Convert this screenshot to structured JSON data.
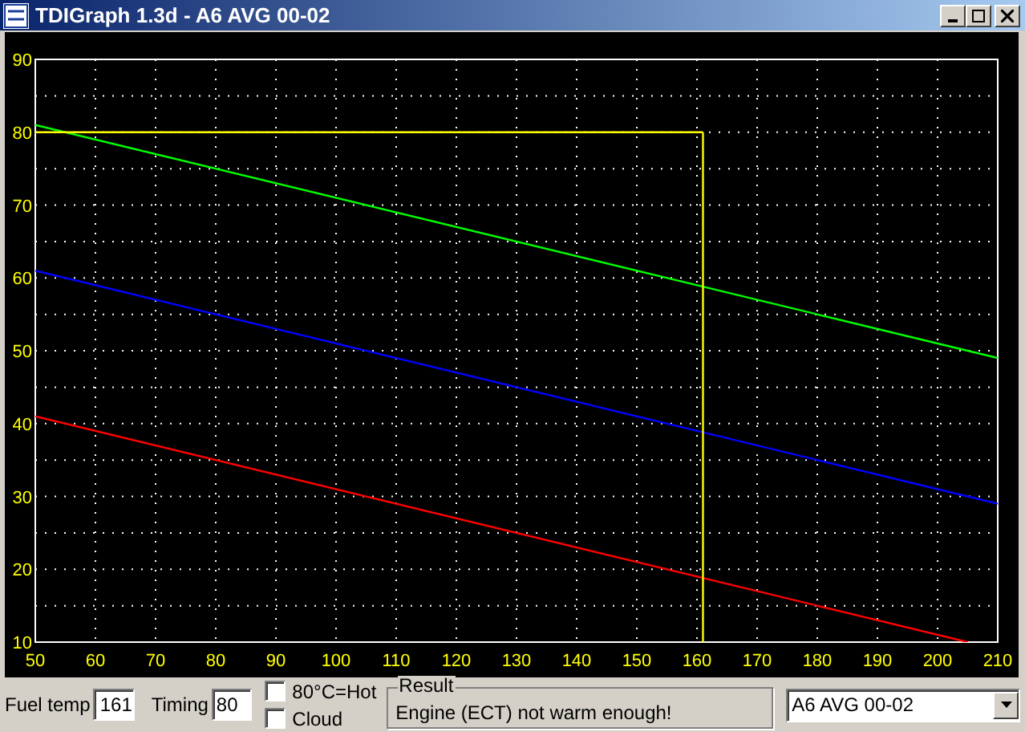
{
  "window": {
    "title": "TDIGraph 1.3d - A6 AVG 00-02"
  },
  "graph": {
    "chart_data": {
      "type": "line",
      "x": [
        50,
        161,
        205,
        210
      ],
      "xlim": [
        50,
        210
      ],
      "ylim": [
        10,
        90
      ],
      "grid": true,
      "xticks": [
        50,
        60,
        70,
        80,
        90,
        100,
        110,
        120,
        130,
        140,
        150,
        160,
        170,
        180,
        190,
        200,
        210
      ],
      "yticks": [
        10,
        20,
        30,
        40,
        50,
        60,
        70,
        80,
        90
      ],
      "series": [
        {
          "color": "#00ff00",
          "values": [
            81,
            58.8,
            50,
            49
          ]
        },
        {
          "color": "#0000ff",
          "values": [
            61,
            38.8,
            30,
            29
          ]
        },
        {
          "color": "#ff0000",
          "values": [
            41,
            18.8,
            10,
            null
          ]
        }
      ],
      "ref_lines": [
        {
          "axis": "y",
          "value": 80,
          "color": "#ffff00"
        },
        {
          "axis": "x",
          "value": 161,
          "color": "#ffff00"
        }
      ]
    }
  },
  "controls": {
    "fuel_temp": {
      "label": "Fuel temp",
      "value": "161"
    },
    "timing": {
      "label": "Timing",
      "value": "80"
    },
    "checkboxes": [
      {
        "label": "80°C=Hot",
        "checked": false
      },
      {
        "label": "Cloud",
        "checked": false
      }
    ],
    "result": {
      "title": "Result",
      "text": "Engine (ECT) not warm enough!"
    },
    "profile": {
      "value": "A6 AVG 00-02"
    }
  }
}
